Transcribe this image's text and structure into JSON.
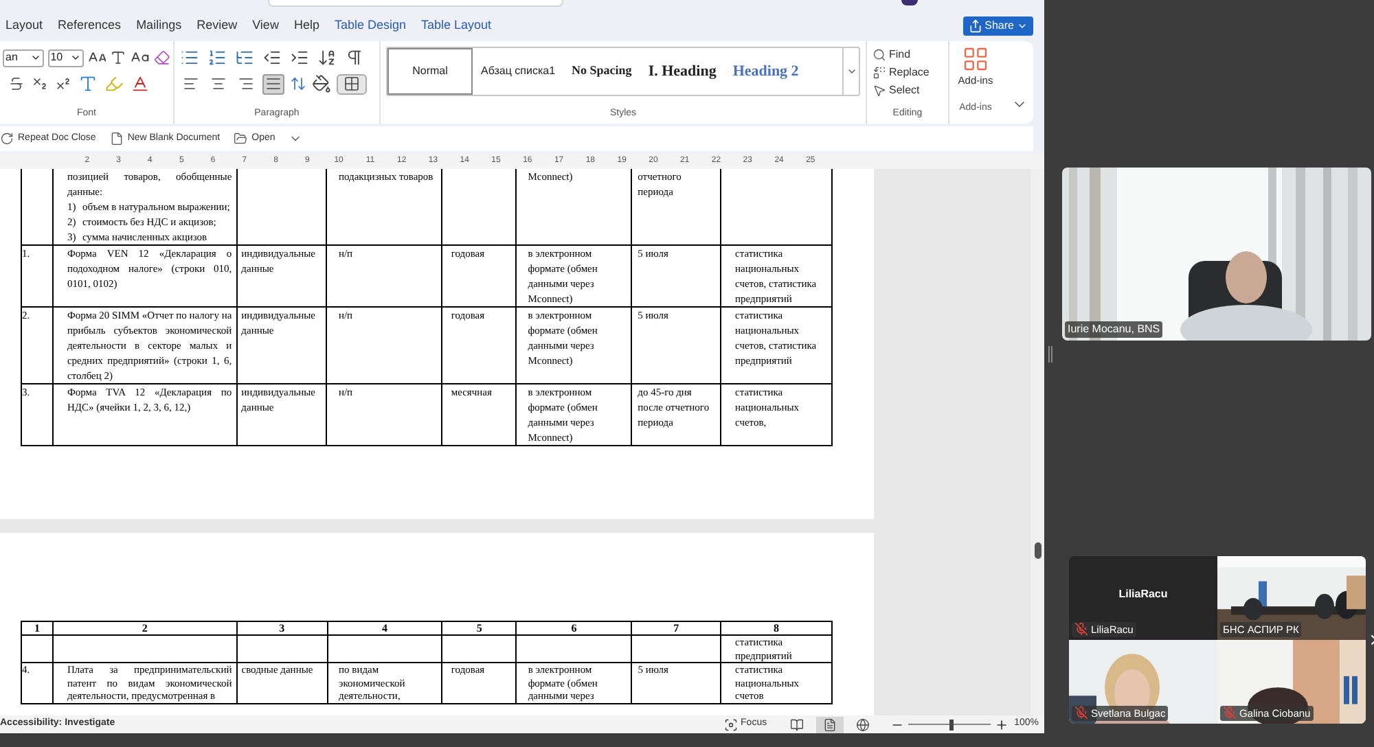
{
  "ribbon_tabs": [
    {
      "label": "Layout",
      "kind": "standard"
    },
    {
      "label": "References",
      "kind": "standard"
    },
    {
      "label": "Mailings",
      "kind": "standard"
    },
    {
      "label": "Review",
      "kind": "standard"
    },
    {
      "label": "View",
      "kind": "standard"
    },
    {
      "label": "Help",
      "kind": "standard"
    },
    {
      "label": "Table Design",
      "kind": "contextual"
    },
    {
      "label": "Table Layout",
      "kind": "contextual"
    }
  ],
  "share_button": {
    "label": "Share"
  },
  "font_group": {
    "font_name": "an",
    "font_size": "10",
    "label": "Font"
  },
  "paragraph_group": {
    "label": "Paragraph",
    "alignment": [
      {
        "kind": "left",
        "selected": false
      },
      {
        "kind": "center",
        "selected": false
      },
      {
        "kind": "right",
        "selected": false
      },
      {
        "kind": "justify",
        "selected": true
      }
    ]
  },
  "styles_group": {
    "label": "Styles",
    "styles": [
      {
        "label": "Normal",
        "kind": "normal",
        "selected": true
      },
      {
        "label": "Абзац списка1",
        "kind": "list",
        "selected": false
      },
      {
        "label": "No Spacing",
        "kind": "nospacing",
        "selected": false
      },
      {
        "label": "I. Heading",
        "kind": "heading1",
        "selected": false
      },
      {
        "label": "Heading 2",
        "kind": "heading2",
        "selected": false
      }
    ]
  },
  "editing_group": {
    "label": "Editing",
    "items": [
      {
        "label": "Find",
        "kind": "find"
      },
      {
        "label": "Replace",
        "kind": "replace"
      },
      {
        "label": "Select",
        "kind": "select"
      }
    ]
  },
  "addins_group": {
    "button": "Add-ins",
    "label": "Add-ins"
  },
  "quick_access": [
    {
      "label": "Repeat Doc Close",
      "kind": "repeat"
    },
    {
      "label": "New Blank Document",
      "kind": "new"
    },
    {
      "label": "Open",
      "kind": "open"
    }
  ],
  "ruler": {
    "numbers": [
      "2",
      "3",
      "4",
      "5",
      "6",
      "7",
      "8",
      "9",
      "10",
      "11",
      "12",
      "13",
      "14",
      "15",
      "16",
      "17",
      "18",
      "19",
      "20",
      "21",
      "22",
      "23",
      "24",
      "25"
    ]
  },
  "document": {
    "page1_rows": [
      {
        "cells": [
          null,
          {
            "text": "позицией товаров, обобщенные данные:",
            "list": [
              {
                "marker": "1)",
                "text": "объем в натуральном выражении;"
              },
              {
                "marker": "2)",
                "text": "стоимость без НДС и акцизов;"
              },
              {
                "marker": "3)",
                "text": "сумма начисленных акцизов"
              }
            ]
          },
          null,
          "подакцизных товаров",
          null,
          "Mconnect)",
          "отчетного периода",
          null
        ]
      },
      {
        "cells": [
          "1.",
          "Форма VEN 12 «Декларация о подоходном налоге» (строки 010, 0101, 0102)",
          "индивидуальные данные",
          "н/п",
          "годовая",
          "в электронном формате (обмен данными через Mconnect)",
          "5 июля",
          "статистика национальных счетов, статистика предприятий"
        ]
      },
      {
        "cells": [
          "2.",
          "Форма 20 SIMM «Отчет по налогу на прибыль субъектов экономической деятельности в секторе малых и средних предприятий» (строки 1, 6, столбец 2)",
          "индивидуальные данные",
          "н/п",
          "годовая",
          "в электронном формате (обмен данными через Mconnect)",
          "5 июля",
          "статистика национальных счетов, статистика предприятий"
        ]
      },
      {
        "cells": [
          "3.",
          "Форма TVA 12 «Декларация по НДС» (ячейки 1, 2, 3, 6, 12,)",
          "индивидуальные данные",
          "н/п",
          "месячная",
          "в электронном формате (обмен данными через Mconnect)",
          "до 45-го дня после отчетного периода",
          "статистика национальных счетов,"
        ]
      }
    ],
    "page2_header": [
      "1",
      "2",
      "3",
      "4",
      "5",
      "6",
      "7",
      "8"
    ],
    "page2_rows": [
      {
        "cells": [
          null,
          null,
          null,
          null,
          null,
          null,
          null,
          "статистика предприятий"
        ]
      },
      {
        "cells": [
          "4.",
          "Плата за предпринимательский патент по видам экономической деятельности, предусмотренная в",
          "сводные данные",
          "по видам экономической деятельности,",
          "годовая",
          "в электронном формате (обмен данными через",
          "5 июля",
          "статистика национальных счетов"
        ]
      }
    ]
  },
  "status_bar": {
    "accessibility": "Accessibility: Investigate",
    "focus": "Focus",
    "views": [
      {
        "kind": "read",
        "selected": false
      },
      {
        "kind": "print",
        "selected": true
      },
      {
        "kind": "web",
        "selected": false
      }
    ],
    "zoom": {
      "level": 0.5,
      "reading": "100%"
    }
  },
  "meeting": {
    "speaker": {
      "name": "Iurie Mocanu, BNS"
    },
    "gallery": [
      {
        "name": "LiliaRacu",
        "kind": "avatar",
        "avatar_name": "LiliaRacu",
        "muted": true
      },
      {
        "name": "БНС АСПИР РК",
        "kind": "room",
        "muted": false
      },
      {
        "name": "Svetlana Bulgac",
        "kind": "blonde",
        "muted": true
      },
      {
        "name": "Galina Ciobanu",
        "kind": "office",
        "muted": true
      }
    ]
  }
}
